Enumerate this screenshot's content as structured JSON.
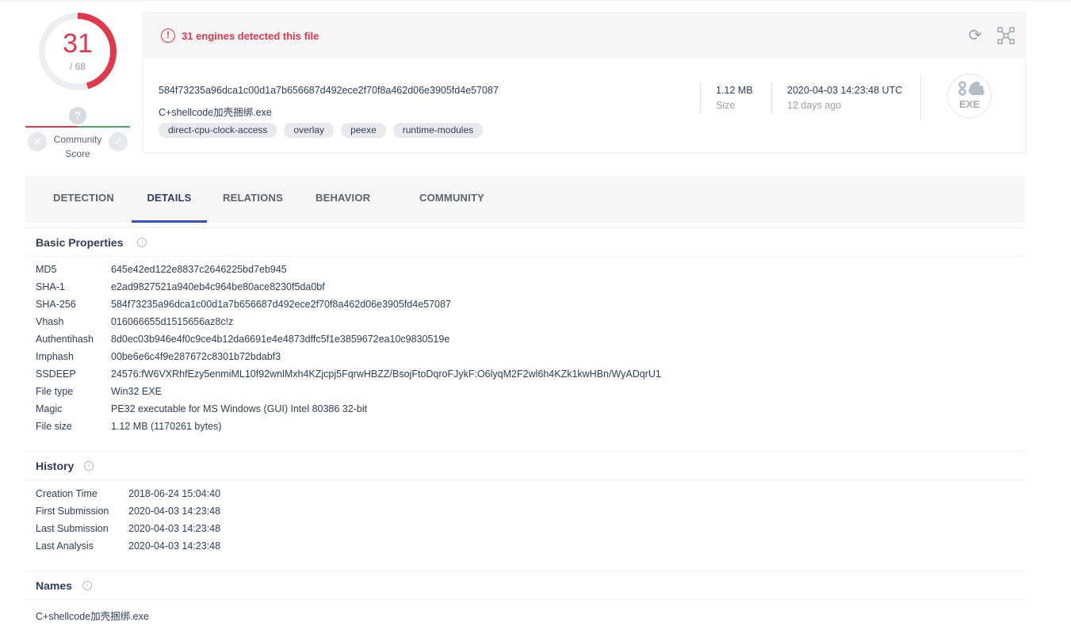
{
  "score": {
    "detections": "31",
    "total": "/ 68",
    "ring_fraction": 0.456,
    "accent": "#e2384d"
  },
  "community": {
    "unknown_mark": "?",
    "label_line1": "Community",
    "label_line2": "Score"
  },
  "header": {
    "alert": "31 engines detected this file",
    "sha256": "584f73235a96dca1c00d1a7b656687d492ece2f70f8a462d06e3905fd4e57087",
    "filename": "C+shellcode加壳捆绑.exe",
    "tags": [
      "direct-cpu-clock-access",
      "overlay",
      "peexe",
      "runtime-modules"
    ],
    "size_value": "1.12 MB",
    "size_label": "Size",
    "date_value": "2020-04-03 14:23:48 UTC",
    "date_ago": "12 days ago",
    "file_type_badge": "EXE",
    "icons": [
      "alert-icon",
      "reload-icon",
      "graph-icon",
      "exe-file-icon"
    ]
  },
  "tabs": [
    "DETECTION",
    "DETAILS",
    "RELATIONS",
    "BEHAVIOR",
    "COMMUNITY"
  ],
  "active_tab": "DETAILS",
  "basic": {
    "title": "Basic Properties",
    "rows": [
      {
        "k": "MD5",
        "v": "645e42ed122e8837c2646225bd7eb945"
      },
      {
        "k": "SHA-1",
        "v": "e2ad9827521a940eb4c964be80ace8230f5da0bf"
      },
      {
        "k": "SHA-256",
        "v": "584f73235a96dca1c00d1a7b656687d492ece2f70f8a462d06e3905fd4e57087"
      },
      {
        "k": "Vhash",
        "v": "016066655d1515656az8c!z"
      },
      {
        "k": "Authentihash",
        "v": "8d0ec03b946e4f0c9ce4b12da6691e4e4873dffc5f1e3859672ea10c9830519e"
      },
      {
        "k": "Imphash",
        "v": "00be6e6c4f9e287672c8301b72bdabf3"
      },
      {
        "k": "SSDEEP",
        "v": "24576:fW6VXRhfEzy5enmiML10f92wnlMxh4KZjcpj5FqrwHBZZ/BsojFtoDqroFJykF:O6lyqM2F2wl6h4KZk1kwHBn/WyADqrU1"
      },
      {
        "k": "File type",
        "v": "Win32 EXE"
      },
      {
        "k": "Magic",
        "v": "PE32 executable for MS Windows (GUI) Intel 80386 32-bit"
      },
      {
        "k": "File size",
        "v": "1.12 MB (1170261 bytes)"
      }
    ]
  },
  "history": {
    "title": "History",
    "rows": [
      {
        "k": "Creation Time",
        "v": "2018-06-24 15:04:40"
      },
      {
        "k": "First Submission",
        "v": "2020-04-03 14:23:48"
      },
      {
        "k": "Last Submission",
        "v": "2020-04-03 14:23:48"
      },
      {
        "k": "Last Analysis",
        "v": "2020-04-03 14:23:48"
      }
    ]
  },
  "names": {
    "title": "Names",
    "items": [
      "C+shellcode加壳捆绑.exe"
    ]
  },
  "info_mark": "i"
}
